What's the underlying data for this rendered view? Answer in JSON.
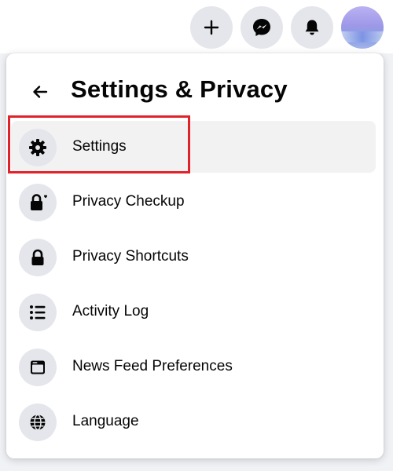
{
  "topbar": {
    "buttons": [
      {
        "icon": "plus-icon"
      },
      {
        "icon": "messenger-icon"
      },
      {
        "icon": "bell-icon"
      }
    ],
    "avatar": "profile-avatar"
  },
  "panel": {
    "title": "Settings & Privacy",
    "back_icon": "arrow-left-icon",
    "items": [
      {
        "label": "Settings",
        "icon": "gear-icon"
      },
      {
        "label": "Privacy Checkup",
        "icon": "lock-heart-icon"
      },
      {
        "label": "Privacy Shortcuts",
        "icon": "lock-icon"
      },
      {
        "label": "Activity Log",
        "icon": "list-icon"
      },
      {
        "label": "News Feed Preferences",
        "icon": "feed-icon"
      },
      {
        "label": "Language",
        "icon": "globe-icon"
      }
    ]
  },
  "colors": {
    "highlight_border": "#e0232a",
    "icon_bg": "#e4e6eb",
    "active_row_bg": "#f2f2f2",
    "text": "#050505"
  }
}
